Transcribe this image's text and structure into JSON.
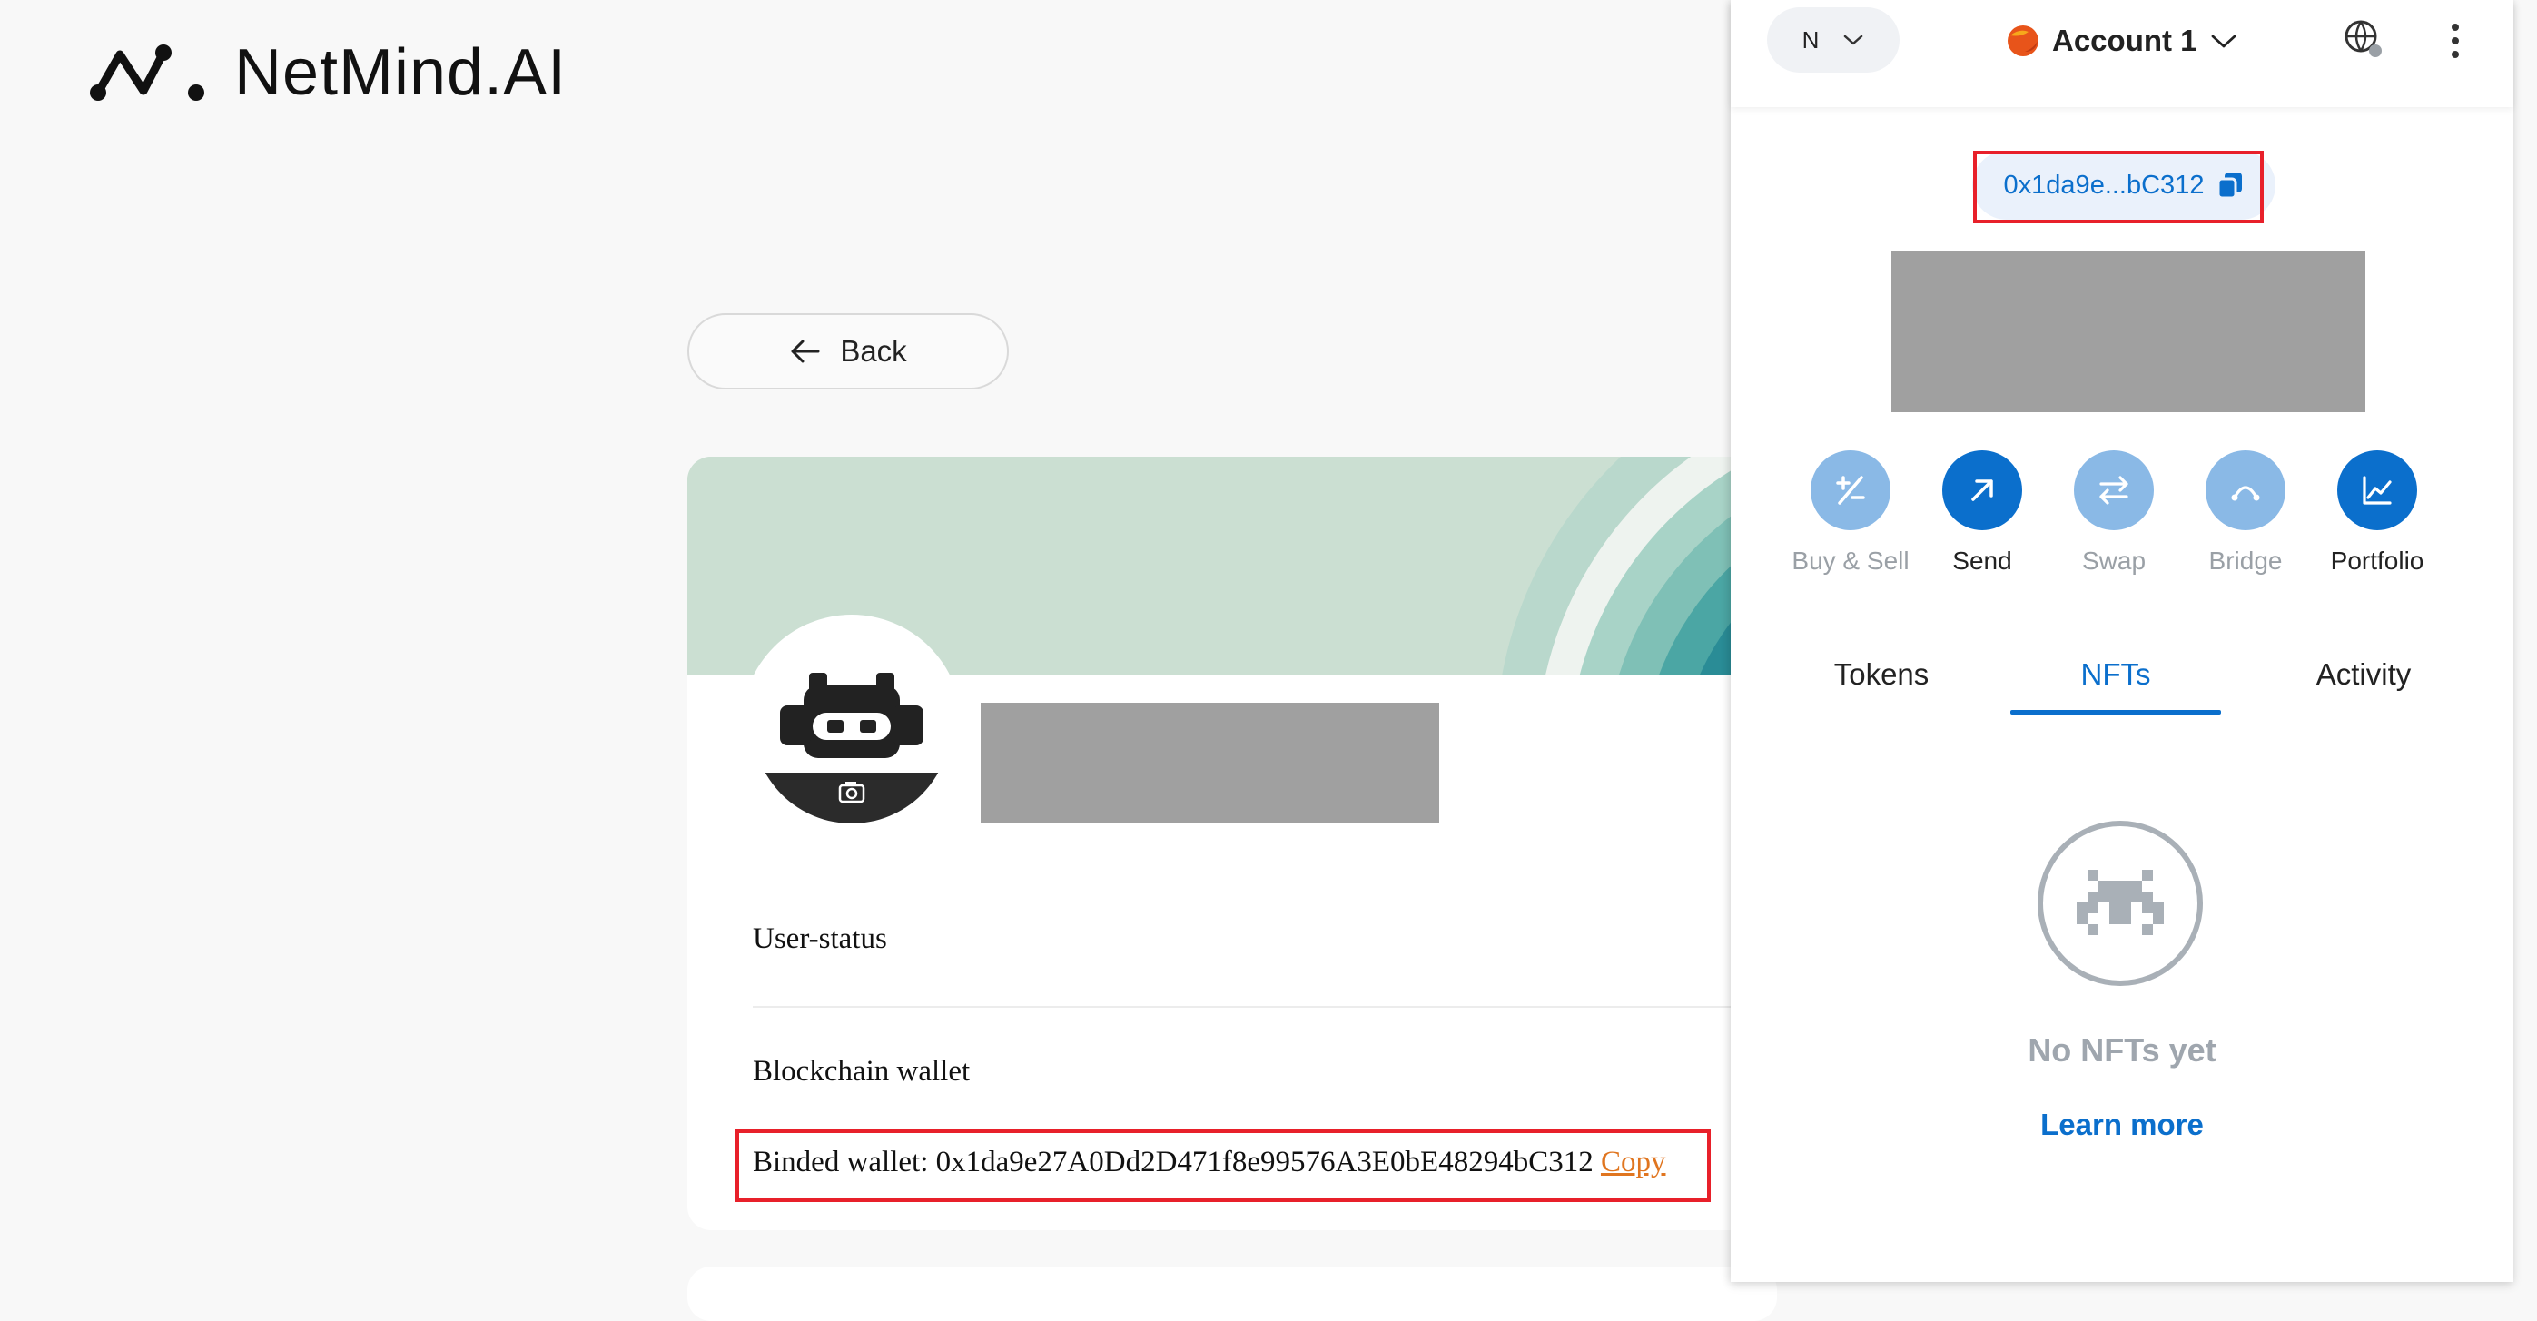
{
  "brand": {
    "name": "NetMind.AI"
  },
  "nav": {
    "back_label": "Back"
  },
  "profile": {
    "user_status_label": "User-status",
    "blockchain_wallet_label": "Blockchain wallet",
    "binded_wallet_text": "Binded wallet: 0x1da9e27A0Dd2D471f8e99576A3E0bE48294bC312",
    "copy_label": "Copy"
  },
  "wallet_panel": {
    "network_badge": "N",
    "account_name": "Account 1",
    "address_short": "0x1da9e...bC312",
    "actions": [
      {
        "label": "Buy & Sell",
        "icon": "plus-minus-icon",
        "enabled": false
      },
      {
        "label": "Send",
        "icon": "arrow-up-right-icon",
        "enabled": true
      },
      {
        "label": "Swap",
        "icon": "swap-arrows-icon",
        "enabled": false
      },
      {
        "label": "Bridge",
        "icon": "bridge-icon",
        "enabled": false
      },
      {
        "label": "Portfolio",
        "icon": "chart-line-icon",
        "enabled": true
      }
    ],
    "tabs": [
      "Tokens",
      "NFTs",
      "Activity"
    ],
    "active_tab": "NFTs",
    "empty_state": {
      "message": "No NFTs yet",
      "link_label": "Learn more"
    }
  },
  "colors": {
    "accent_blue": "#0b6fcc",
    "disabled_blue": "#8ab9e6",
    "highlight_red": "#e8202a",
    "copy_orange": "#e0751f"
  }
}
